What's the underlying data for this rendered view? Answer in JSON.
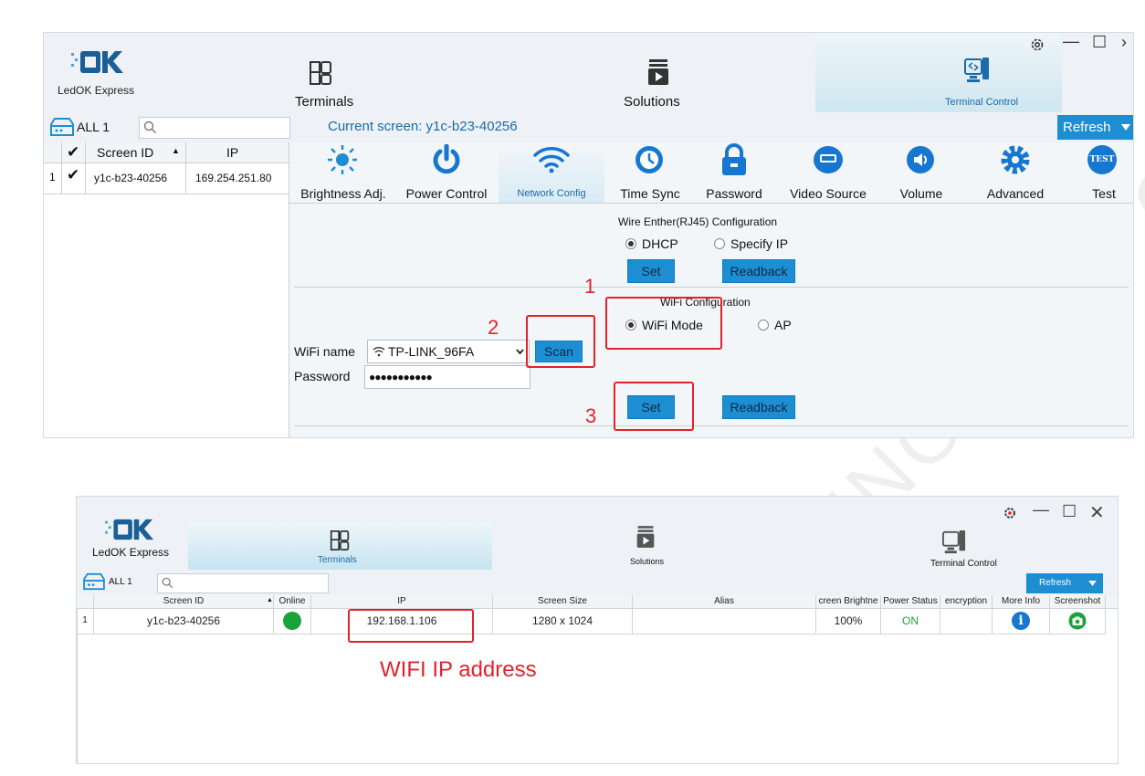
{
  "top_screenshot": {
    "brand": "LedOK Express",
    "nav": {
      "terminals": "Terminals",
      "solutions": "Solutions",
      "terminal_control": "Terminal Control"
    },
    "sidebar": {
      "group_label": "ALL 1",
      "search_placeholder": ""
    },
    "current_screen": "Current screen: y1c-b23-40256",
    "refresh_label": "Refresh",
    "grid": {
      "check_mark": "✔",
      "columns": [
        "Screen ID",
        "IP"
      ],
      "rows": [
        {
          "index": "1",
          "check": "✔",
          "screen_id": "y1c-b23-40256",
          "ip": "169.254.251.80"
        }
      ]
    },
    "tools": [
      {
        "label": "Brightness Adj.",
        "icon": "brightness-sun-icon"
      },
      {
        "label": "Power Control",
        "icon": "power-icon"
      },
      {
        "label": "Network Config",
        "icon": "wifi-icon"
      },
      {
        "label": "Time Sync",
        "icon": "clock-icon"
      },
      {
        "label": "Password",
        "icon": "lock-icon"
      },
      {
        "label": "Video Source",
        "icon": "video-source-icon"
      },
      {
        "label": "Volume",
        "icon": "volume-icon"
      },
      {
        "label": "Advanced",
        "icon": "gear-icon"
      },
      {
        "label": "Test",
        "icon": "test-icon"
      }
    ],
    "test_icon_text": "TEST",
    "wired": {
      "title": "Wire Enther(RJ45) Configuration",
      "dhcp": "DHCP",
      "specify_ip": "Specify IP",
      "set": "Set",
      "readback": "Readback"
    },
    "wifi": {
      "title": "WiFi Configuration",
      "wifi_mode": "WiFi Mode",
      "ap": "AP",
      "name_label": "WiFi name",
      "network": "TP-LINK_96FA",
      "scan": "Scan",
      "password_label": "Password",
      "password_value": "●●●●●●●●●●●",
      "set": "Set",
      "readback": "Readback"
    },
    "annotations": {
      "step1": "1",
      "step2": "2",
      "step3": "3"
    }
  },
  "bottom_screenshot": {
    "brand": "LedOK Express",
    "nav": {
      "terminals": "Terminals",
      "solutions": "Solutions",
      "terminal_control": "Terminal Control"
    },
    "group_label": "ALL 1",
    "refresh_label": "Refresh",
    "table": {
      "columns": [
        "",
        "Screen ID",
        "Online",
        "IP",
        "Screen Size",
        "Alias",
        "creen Brightne",
        "Power Status",
        "encryption",
        "More Info",
        "Screenshot"
      ],
      "rows": [
        {
          "index": "1",
          "screen_id": "y1c-b23-40256",
          "online": true,
          "ip": "192.168.1.106",
          "screen_size": "1280 x 1024",
          "alias": "",
          "brightness": "100%",
          "power_status": "ON",
          "encryption": ""
        }
      ]
    },
    "annotation": "WIFI IP address"
  },
  "colors": {
    "accent_blue": "#1e8ed3",
    "annotation_red": "#e2222a",
    "online_green": "#1aa33a",
    "icon_blue": "#1677d2"
  }
}
